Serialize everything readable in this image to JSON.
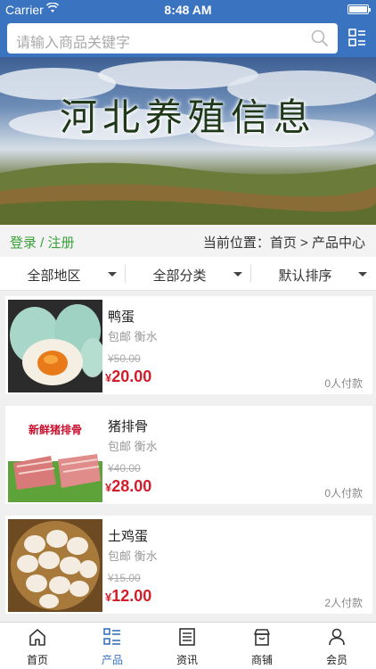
{
  "status_bar": {
    "carrier": "Carrier",
    "time": "8:48 AM"
  },
  "search": {
    "placeholder": "请输入商品关键字"
  },
  "banner": {
    "title": "河北养殖信息"
  },
  "breadcrumb": {
    "login_register": "登录 / 注册",
    "location": "当前位置：首页 > 产品中心"
  },
  "filters": [
    {
      "label": "全部地区"
    },
    {
      "label": "全部分类"
    },
    {
      "label": "默认排序"
    }
  ],
  "products": [
    {
      "name": "鸭蛋",
      "meta": "包邮 衡水",
      "old_price": "¥50.00",
      "price_symbol": "¥",
      "price": "20.00",
      "paid": "0人付款"
    },
    {
      "name": "猪排骨",
      "meta": "包邮 衡水",
      "old_price": "¥40.00",
      "price_symbol": "¥",
      "price": "28.00",
      "paid": "0人付款",
      "image_caption": "新鲜猪排骨"
    },
    {
      "name": "土鸡蛋",
      "meta": "包邮 衡水",
      "old_price": "¥15.00",
      "price_symbol": "¥",
      "price": "12.00",
      "paid": "2人付款"
    }
  ],
  "tabbar": [
    {
      "label": "首页",
      "icon": "home-icon"
    },
    {
      "label": "产品",
      "icon": "list-icon",
      "active": true
    },
    {
      "label": "资讯",
      "icon": "news-icon"
    },
    {
      "label": "商铺",
      "icon": "shop-icon"
    },
    {
      "label": "会员",
      "icon": "user-icon"
    }
  ],
  "colors": {
    "header": "#3a73c0",
    "price": "#d21e2b",
    "login": "#3aa03a"
  }
}
